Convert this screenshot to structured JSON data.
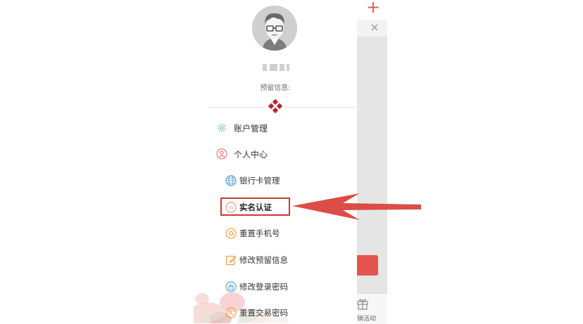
{
  "drawer": {
    "reserved_info_label": "预留信息:",
    "menu": [
      {
        "label": "账户管理",
        "icon": "gear-icon"
      },
      {
        "label": "个人中心",
        "icon": "person-icon"
      }
    ],
    "submenu": [
      {
        "label": "银行卡管理",
        "icon": "globe-icon"
      },
      {
        "label": "实名认证",
        "icon": "id-badge-icon"
      },
      {
        "label": "重置手机号",
        "icon": "at-sign-icon"
      },
      {
        "label": "修改预留信息",
        "icon": "edit-icon"
      },
      {
        "label": "修改登录密码",
        "icon": "lock-icon"
      },
      {
        "label": "重置交易密码",
        "icon": "key-icon"
      }
    ]
  },
  "background": {
    "plus_symbol": "+",
    "close_symbol": "×",
    "activity_label": "销活动"
  },
  "colors": {
    "accent_red": "#e25450",
    "annotation_red": "#d0372c",
    "logo_red": "#b5282e"
  }
}
